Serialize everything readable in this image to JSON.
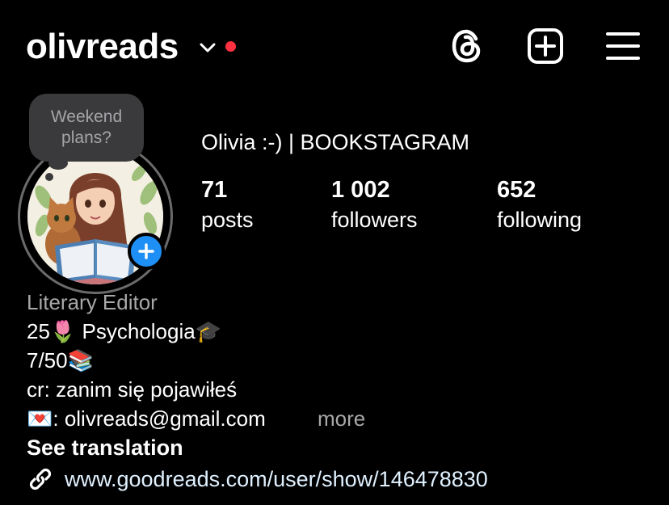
{
  "header": {
    "username": "olivreads",
    "icons": [
      "chevron-down-icon",
      "threads-icon",
      "new-post-icon",
      "menu-icon"
    ],
    "notification_color": "#ff3040"
  },
  "note": {
    "text": "Weekend\nplans?"
  },
  "profile": {
    "display_name": "Olivia :-) | BOOKSTAGRAM",
    "stats": [
      {
        "value": "71",
        "label": "posts"
      },
      {
        "value": "1 002",
        "label": "followers"
      },
      {
        "value": "652",
        "label": "following"
      }
    ]
  },
  "bio": {
    "category": "Literary Editor",
    "lines": [
      "25🌷 Psychologia🎓",
      "7/50📚",
      "cr: zanim się pojawiłeś",
      "💌: olivreads@gmail.com"
    ],
    "more_label": "more",
    "see_translation_label": "See translation",
    "link": "www.goodreads.com/user/show/146478830"
  },
  "colors": {
    "accent_blue": "#1e8ff5",
    "background": "#000000",
    "secondary_text": "#a8a8a8"
  }
}
